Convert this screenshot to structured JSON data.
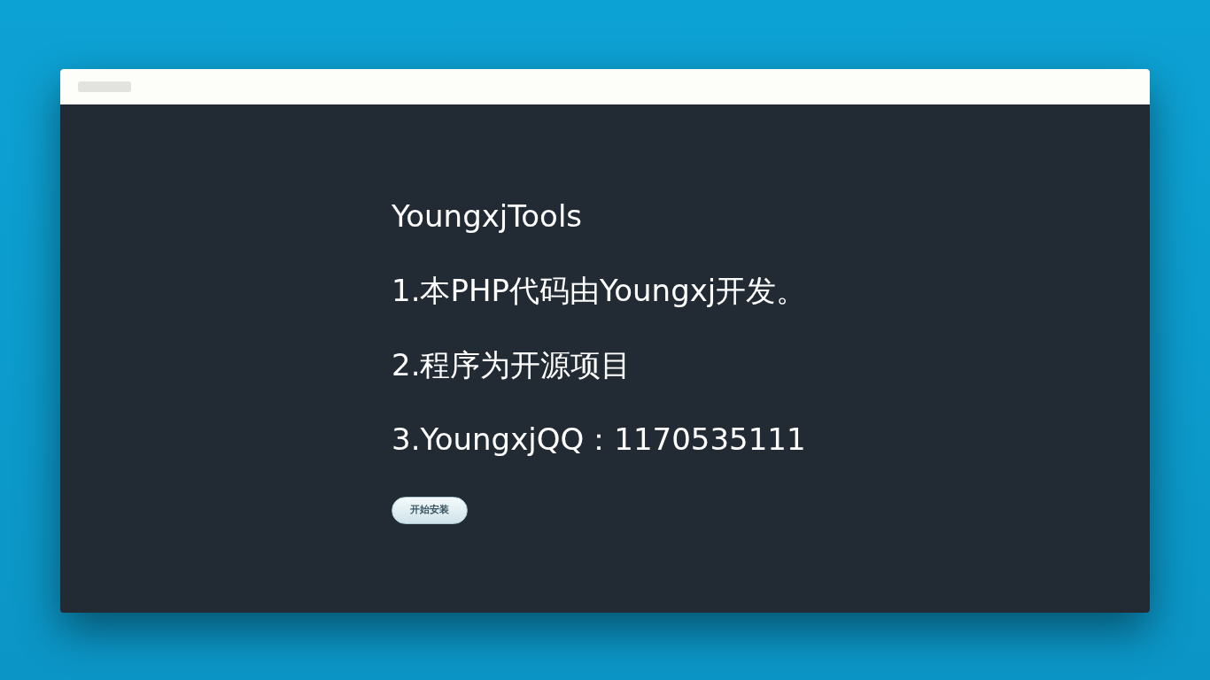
{
  "title": "YoungxjTools",
  "lines": [
    "1.本PHP代码由Youngxj开发。",
    "2.程序为开源项目",
    "3.YoungxjQQ：1170535111"
  ],
  "button": "开始安装"
}
